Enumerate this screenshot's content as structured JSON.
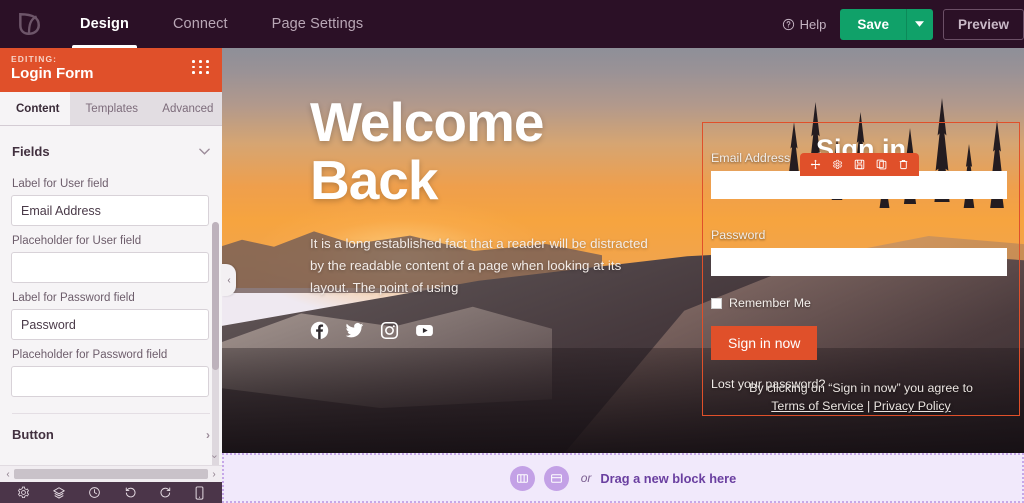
{
  "topbar": {
    "logo": "leaf-logo",
    "tabs": [
      {
        "label": "Design",
        "active": true
      },
      {
        "label": "Connect",
        "active": false
      },
      {
        "label": "Page Settings",
        "active": false
      }
    ],
    "help_label": "Help",
    "save_label": "Save",
    "preview_label": "Preview",
    "accent_green": "#10a169",
    "bar_color": "#2b1026"
  },
  "panel": {
    "editing_label": "EDITING:",
    "title": "Login Form",
    "accent": "#e0502a",
    "tabs": [
      {
        "label": "Content",
        "icon": "pencil-icon",
        "active": true
      },
      {
        "label": "Templates",
        "icon": "template-icon",
        "active": false
      },
      {
        "label": "Advanced",
        "icon": "sliders-icon",
        "active": false
      }
    ],
    "sections": {
      "fields": {
        "title": "Fields",
        "rows": [
          {
            "label": "Label for User field",
            "value": "Email Address",
            "placeholder": ""
          },
          {
            "label": "Placeholder for User field",
            "value": "",
            "placeholder": ""
          },
          {
            "label": "Label for Password field",
            "value": "Password",
            "placeholder": ""
          },
          {
            "label": "Placeholder for Password field",
            "value": "",
            "placeholder": ""
          }
        ]
      },
      "button": {
        "title": "Button"
      }
    }
  },
  "bottom_tools": [
    {
      "name": "settings-icon",
      "title": "Settings"
    },
    {
      "name": "layers-icon",
      "title": "Layers"
    },
    {
      "name": "history-icon",
      "title": "Revision History"
    },
    {
      "name": "undo-icon",
      "title": "Undo"
    },
    {
      "name": "redo-icon",
      "title": "Redo"
    },
    {
      "name": "mobile-icon",
      "title": "Mobile Preview"
    }
  ],
  "canvas": {
    "hero": {
      "title_line1": "Welcome",
      "title_line2": "Back",
      "paragraph": "It is a long established fact that a reader will be distracted by the readable content of a page when looking at its layout. The point of using",
      "social": [
        "facebook-icon",
        "twitter-icon",
        "instagram-icon",
        "youtube-icon"
      ]
    },
    "login_form": {
      "heading": "Sign in",
      "email_label": "Email Address",
      "email_value": "",
      "password_label": "Password",
      "password_value": "",
      "remember_label": "Remember Me",
      "submit_label": "Sign in now",
      "lost_password_label": "Lost your password?",
      "terms_prefix": "By clicking on “Sign in now” you agree to",
      "terms_link": "Terms of Service",
      "terms_separator": "|",
      "privacy_link": "Privacy Policy",
      "toolbar": [
        {
          "name": "move-icon"
        },
        {
          "name": "gear-icon"
        },
        {
          "name": "save-icon"
        },
        {
          "name": "duplicate-icon"
        },
        {
          "name": "trash-icon"
        }
      ]
    }
  },
  "dropzone": {
    "or_label": "or",
    "text": "Drag a new block here",
    "buttons": [
      {
        "name": "columns-icon"
      },
      {
        "name": "rows-icon"
      }
    ]
  }
}
